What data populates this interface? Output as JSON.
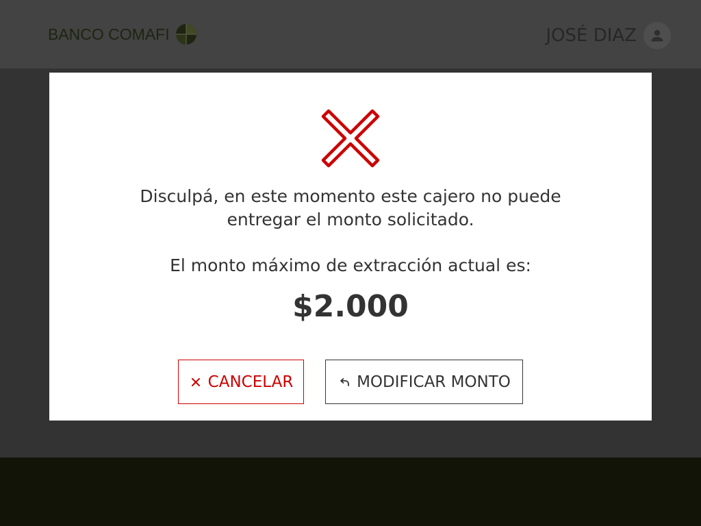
{
  "header": {
    "logo_text": "BANCO COMAFI",
    "logo_icon": "comafi-globe-logo",
    "user_name": "JOSÉ DIAZ",
    "avatar_icon": "person-icon"
  },
  "dialog": {
    "icon": "error-x-icon",
    "icon_color": "#cc0000",
    "message_line1": "Disculpá, en este momento este cajero no puede",
    "message_line2": "entregar el monto solicitado.",
    "limit_label": "El monto máximo de extracción actual es:",
    "limit_amount": "$2.000",
    "buttons": {
      "cancel_label": "CANCELAR",
      "cancel_icon": "close-icon",
      "modify_label": "MODIFICAR MONTO",
      "modify_icon": "undo-arrow-icon"
    }
  },
  "colors": {
    "accent": "#cc0000",
    "overlay": "#333333",
    "header_bg": "#434343",
    "footer_bg": "#111407",
    "text": "#333333"
  }
}
